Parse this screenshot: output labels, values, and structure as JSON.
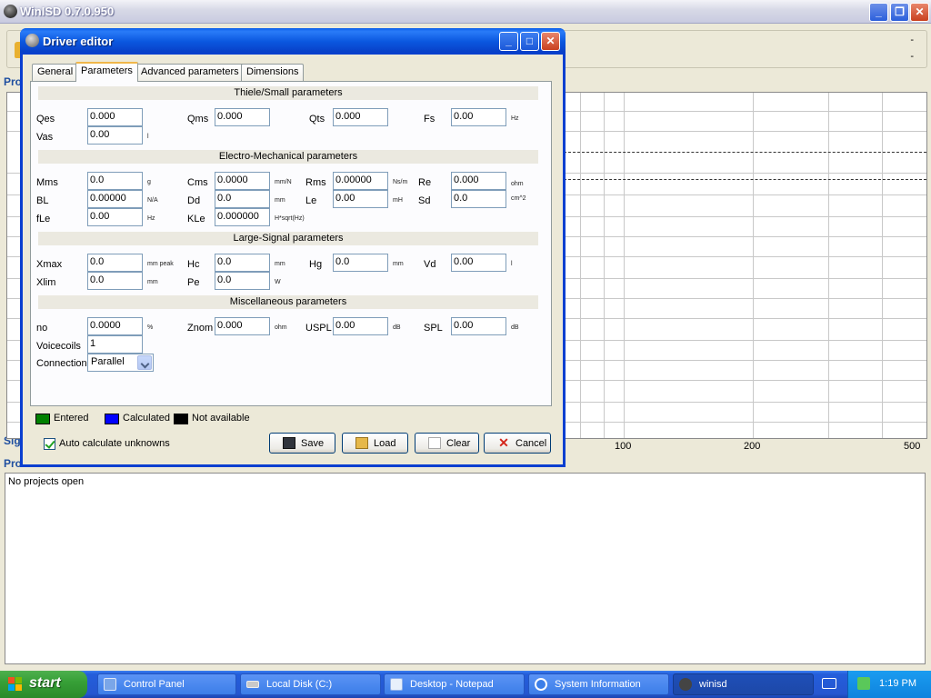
{
  "main_window": {
    "title": "WinISD 0.7.0.950",
    "toolbar_dashes": [
      "-",
      "-"
    ],
    "section_labels": [
      "Pro",
      "Sig",
      "Pro"
    ],
    "x_ticks": [
      "100",
      "200",
      "500"
    ],
    "projects_message": "No projects open"
  },
  "dialog": {
    "title": "Driver editor",
    "tabs": [
      {
        "label": "General",
        "active": false
      },
      {
        "label": "Parameters",
        "active": true
      },
      {
        "label": "Advanced parameters",
        "active": false
      },
      {
        "label": "Dimensions",
        "active": false
      }
    ],
    "groups": {
      "thiele": "Thiele/Small parameters",
      "electro": "Electro-Mechanical parameters",
      "large": "Large-Signal parameters",
      "misc": "Miscellaneous parameters"
    },
    "params": {
      "qes": {
        "label": "Qes",
        "value": "0.000",
        "unit": ""
      },
      "qms": {
        "label": "Qms",
        "value": "0.000",
        "unit": ""
      },
      "qts": {
        "label": "Qts",
        "value": "0.000",
        "unit": ""
      },
      "fs": {
        "label": "Fs",
        "value": "0.00",
        "unit": "Hz"
      },
      "vas": {
        "label": "Vas",
        "value": "0.00",
        "unit": "l"
      },
      "mms": {
        "label": "Mms",
        "value": "0.0",
        "unit": "g"
      },
      "cms": {
        "label": "Cms",
        "value": "0.0000",
        "unit": "mm/N"
      },
      "rms": {
        "label": "Rms",
        "value": "0.00000",
        "unit": "Ns/m"
      },
      "re": {
        "label": "Re",
        "value": "0.000",
        "unit": "ohm"
      },
      "bl": {
        "label": "BL",
        "value": "0.00000",
        "unit": "N/A"
      },
      "dd": {
        "label": "Dd",
        "value": "0.0",
        "unit": "mm"
      },
      "le": {
        "label": "Le",
        "value": "0.00",
        "unit": "mH"
      },
      "sd": {
        "label": "Sd",
        "value": "0.0",
        "unit": "cm^2"
      },
      "fle": {
        "label": "fLe",
        "value": "0.00",
        "unit": "Hz"
      },
      "kle": {
        "label": "KLe",
        "value": "0.000000",
        "unit": "H*sqrt(Hz)"
      },
      "xmax": {
        "label": "Xmax",
        "value": "0.0",
        "unit": "mm  peak"
      },
      "hc": {
        "label": "Hc",
        "value": "0.0",
        "unit": "mm"
      },
      "hg": {
        "label": "Hg",
        "value": "0.0",
        "unit": "mm"
      },
      "vd": {
        "label": "Vd",
        "value": "0.00",
        "unit": "l"
      },
      "xlim": {
        "label": "Xlim",
        "value": "0.0",
        "unit": "mm"
      },
      "pe": {
        "label": "Pe",
        "value": "0.0",
        "unit": "W"
      },
      "no": {
        "label": "no",
        "value": "0.0000",
        "unit": "%"
      },
      "znom": {
        "label": "Znom",
        "value": "0.000",
        "unit": "ohm"
      },
      "uspl": {
        "label": "USPL",
        "value": "0.00",
        "unit": "dB"
      },
      "spl": {
        "label": "SPL",
        "value": "0.00",
        "unit": "dB"
      },
      "voicecoils": {
        "label": "Voicecoils",
        "value": "1"
      },
      "connection": {
        "label": "Connection",
        "value": "Parallel"
      }
    },
    "legend": [
      {
        "label": "Entered",
        "color": "#008000"
      },
      {
        "label": "Calculated",
        "color": "#0000ff"
      },
      {
        "label": "Not available",
        "color": "#000000"
      }
    ],
    "auto_calculate": {
      "label": "Auto calculate unknowns",
      "checked": true
    },
    "buttons": {
      "save": "Save",
      "load": "Load",
      "clear": "Clear",
      "cancel": "Cancel"
    }
  },
  "taskbar": {
    "start": "start",
    "items": [
      {
        "label": "Control Panel",
        "active": false
      },
      {
        "label": "Local Disk (C:)",
        "active": false
      },
      {
        "label": "Desktop - Notepad",
        "active": false
      },
      {
        "label": "System Information",
        "active": false
      },
      {
        "label": "winisd",
        "active": true
      }
    ],
    "clock": "1:19 PM"
  }
}
